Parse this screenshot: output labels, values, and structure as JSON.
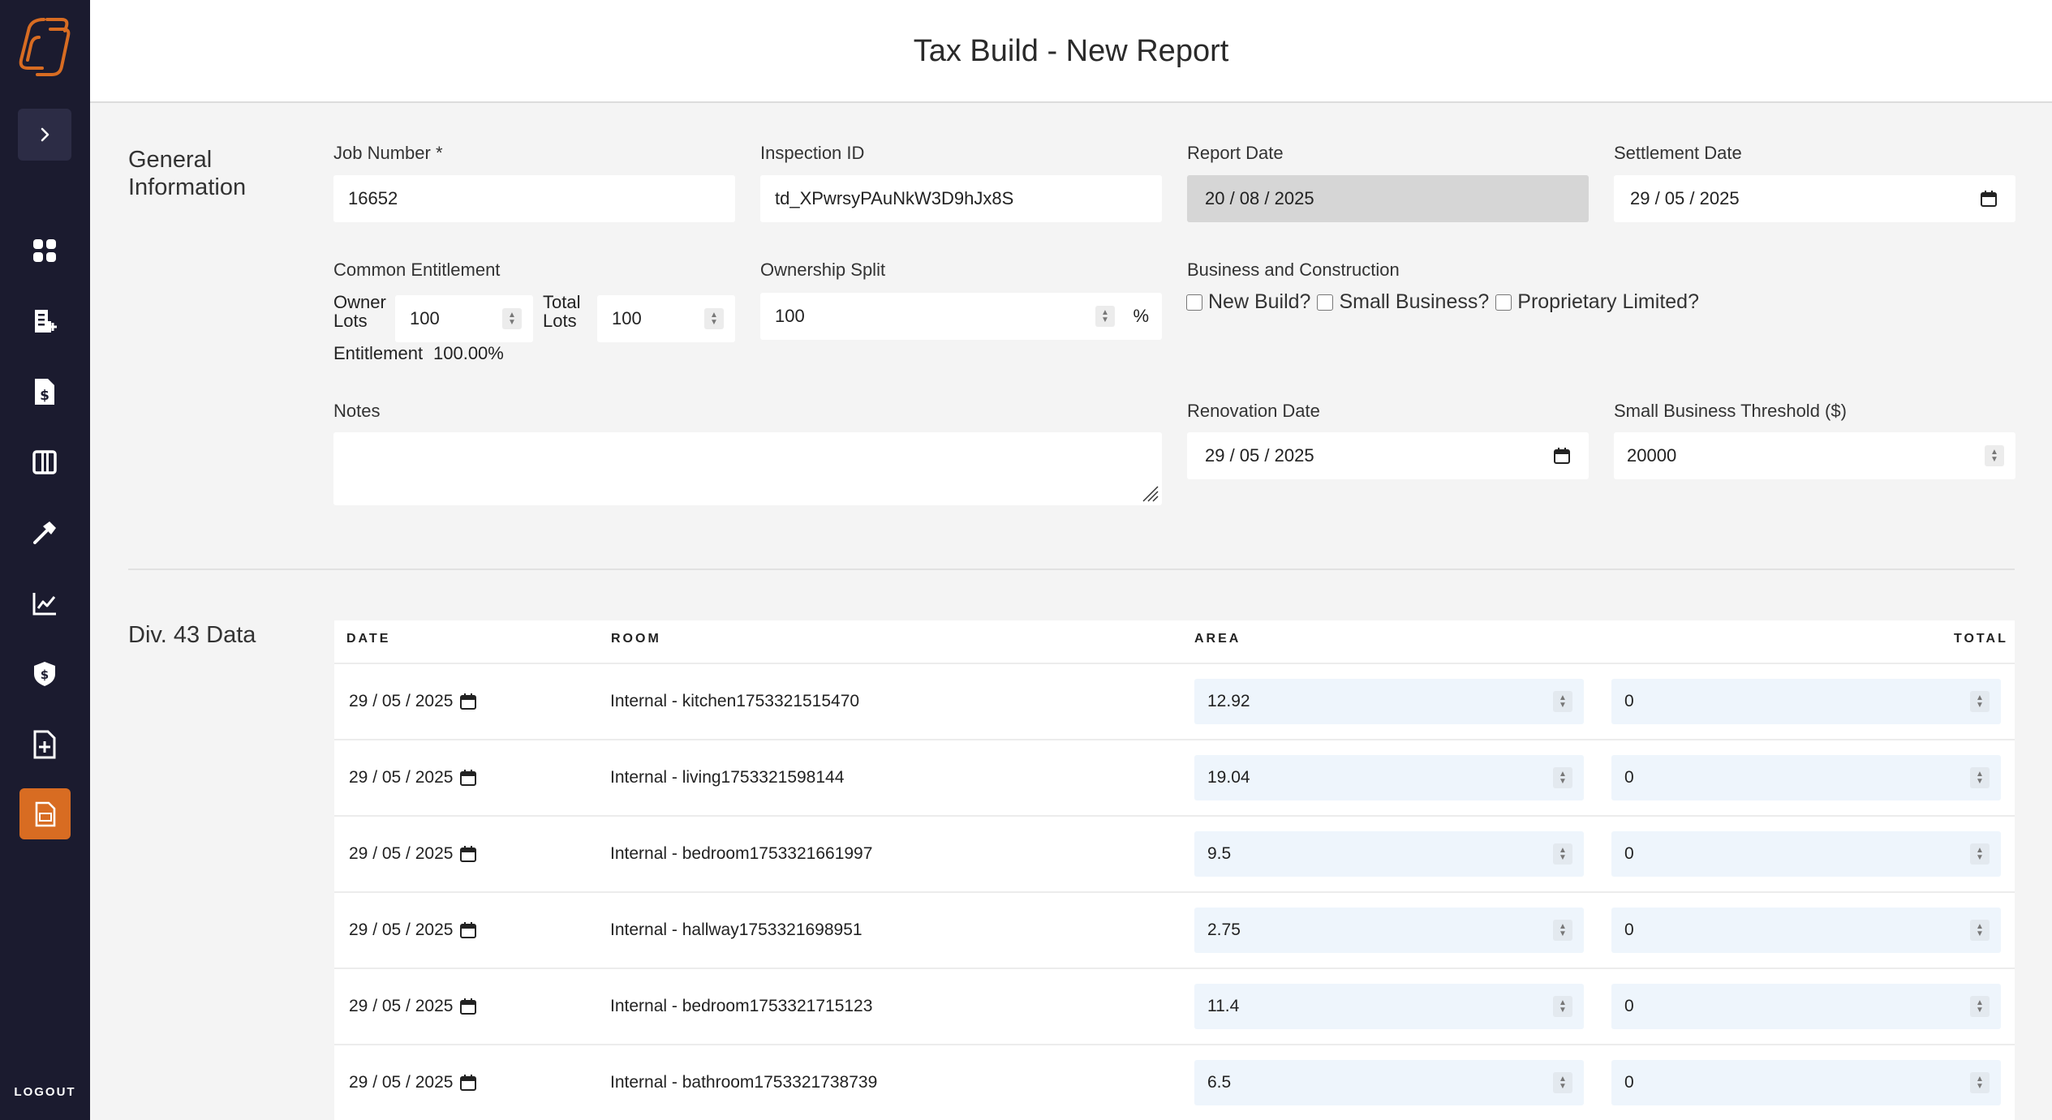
{
  "header": {
    "title": "Tax Build - New Report"
  },
  "sidebar": {
    "logout_label": "LOGOUT",
    "accent_color": "#d86c22",
    "bg_color": "#1b1b2f",
    "nav_icons": [
      "dashboard-icon",
      "new-invoice-icon",
      "invoice-dollar-icon",
      "columns-icon",
      "hammer-icon",
      "chart-line-icon",
      "shield-dollar-icon",
      "file-add-icon",
      "report-icon"
    ]
  },
  "general": {
    "section_label": "General Information",
    "job_number": {
      "label": "Job Number *",
      "value": "16652"
    },
    "inspection_id": {
      "label": "Inspection ID",
      "value": "td_XPwrsyPAuNkW3D9hJx8S"
    },
    "report_date": {
      "label": "Report Date",
      "value": "20 / 08 / 2025"
    },
    "settlement_date": {
      "label": "Settlement Date",
      "value": "29 / 05 / 2025"
    },
    "common_entitlement": {
      "label": "Common Entitlement",
      "owner_lots_label_1": "Owner",
      "owner_lots_label_2": "Lots",
      "owner_lots_value": "100",
      "total_lots_label_1": "Total",
      "total_lots_label_2": "Lots",
      "total_lots_value": "100",
      "entitlement_label": "Entitlement",
      "entitlement_value": "100.00%"
    },
    "ownership_split": {
      "label": "Ownership Split",
      "value": "100",
      "unit": "%"
    },
    "business": {
      "label": "Business and Construction",
      "new_build": "New Build?",
      "small_business": "Small Business?",
      "proprietary_limited": "Proprietary Limited?"
    },
    "notes": {
      "label": "Notes",
      "value": ""
    },
    "renovation_date": {
      "label": "Renovation Date",
      "value": "29 / 05 / 2025"
    },
    "small_business_threshold": {
      "label": "Small Business Threshold ($)",
      "value": "20000"
    }
  },
  "div43": {
    "section_label": "Div. 43 Data",
    "columns": {
      "date": "DATE",
      "room": "ROOM",
      "area": "AREA",
      "total": "TOTAL"
    },
    "rows": [
      {
        "date": "29 / 05 / 2025",
        "room": "Internal - kitchen1753321515470",
        "area": "12.92",
        "total": "0"
      },
      {
        "date": "29 / 05 / 2025",
        "room": "Internal - living1753321598144",
        "area": "19.04",
        "total": "0"
      },
      {
        "date": "29 / 05 / 2025",
        "room": "Internal - bedroom1753321661997",
        "area": "9.5",
        "total": "0"
      },
      {
        "date": "29 / 05 / 2025",
        "room": "Internal - hallway1753321698951",
        "area": "2.75",
        "total": "0"
      },
      {
        "date": "29 / 05 / 2025",
        "room": "Internal - bedroom1753321715123",
        "area": "11.4",
        "total": "0"
      },
      {
        "date": "29 / 05 / 2025",
        "room": "Internal - bathroom1753321738739",
        "area": "6.5",
        "total": "0"
      }
    ]
  }
}
